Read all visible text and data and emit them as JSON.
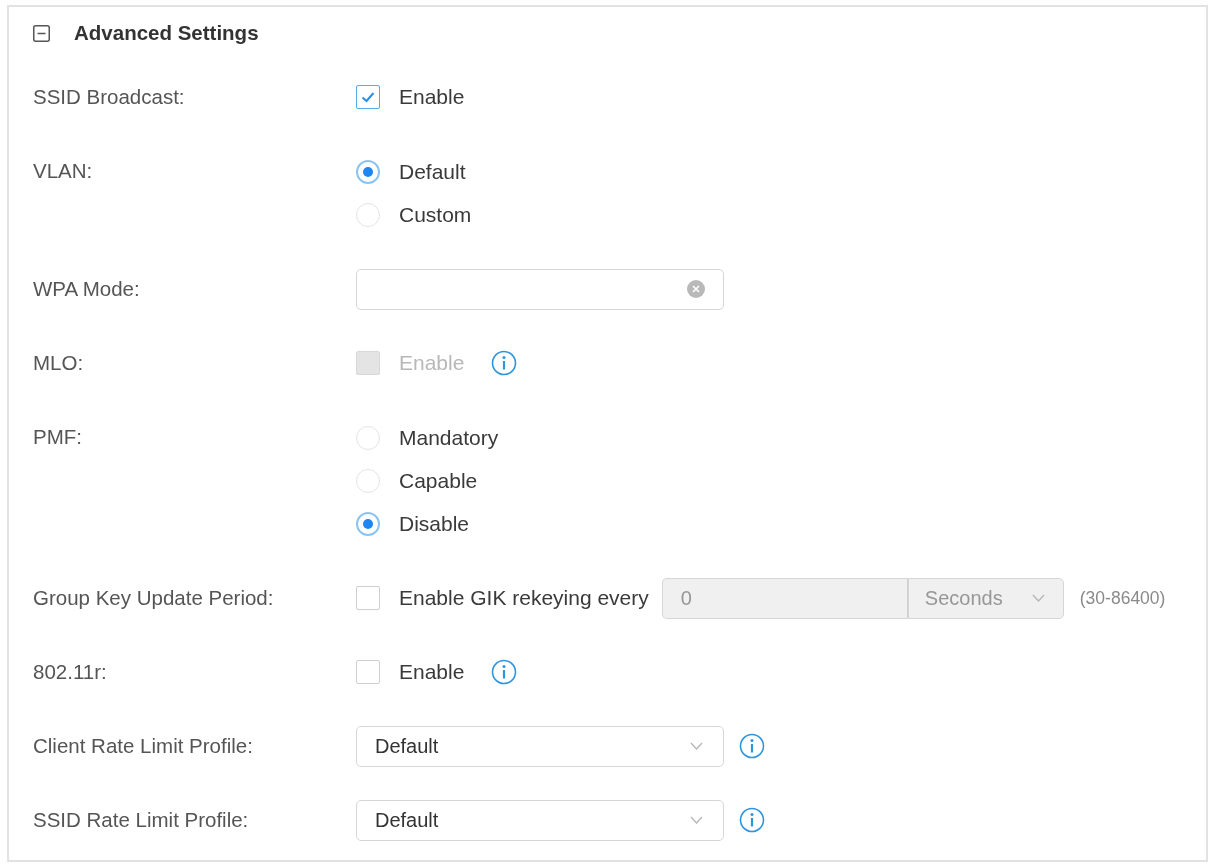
{
  "section": {
    "title": "Advanced Settings",
    "expanded": true
  },
  "rows": [
    {
      "kind": "checkbox",
      "label": "SSID Broadcast:",
      "option": {
        "text": "Enable",
        "checked": true,
        "disabled": false
      },
      "info": false
    },
    {
      "kind": "radio",
      "label": "VLAN:",
      "options": [
        {
          "text": "Default",
          "selected": true
        },
        {
          "text": "Custom",
          "selected": false
        }
      ],
      "info": false
    },
    {
      "kind": "input",
      "label": "WPA Mode:",
      "info": false
    },
    {
      "kind": "checkbox",
      "label": "MLO:",
      "option": {
        "text": "Enable",
        "checked": false,
        "disabled": true
      },
      "info": true
    },
    {
      "kind": "radio",
      "label": "PMF:",
      "options": [
        {
          "text": "Mandatory",
          "selected": false
        },
        {
          "text": "Capable",
          "selected": false
        },
        {
          "text": "Disable",
          "selected": true
        }
      ],
      "info": false
    },
    {
      "kind": "period",
      "label": "Group Key Update Period:",
      "option": {
        "text": "Enable GIK rekeying every",
        "checked": false,
        "disabled": false
      },
      "period": {
        "value": "0",
        "unit": "Seconds",
        "disabled": true
      },
      "range": "(30-86400)",
      "info": false
    },
    {
      "kind": "checkbox",
      "label": "802.11r:",
      "option": {
        "text": "Enable",
        "checked": false,
        "disabled": false
      },
      "info": true
    },
    {
      "kind": "select",
      "label": "Client Rate Limit Profile:",
      "value": "Default",
      "info": true
    },
    {
      "kind": "select",
      "label": "SSID Rate Limit Profile:",
      "value": "Default",
      "info": true
    }
  ]
}
